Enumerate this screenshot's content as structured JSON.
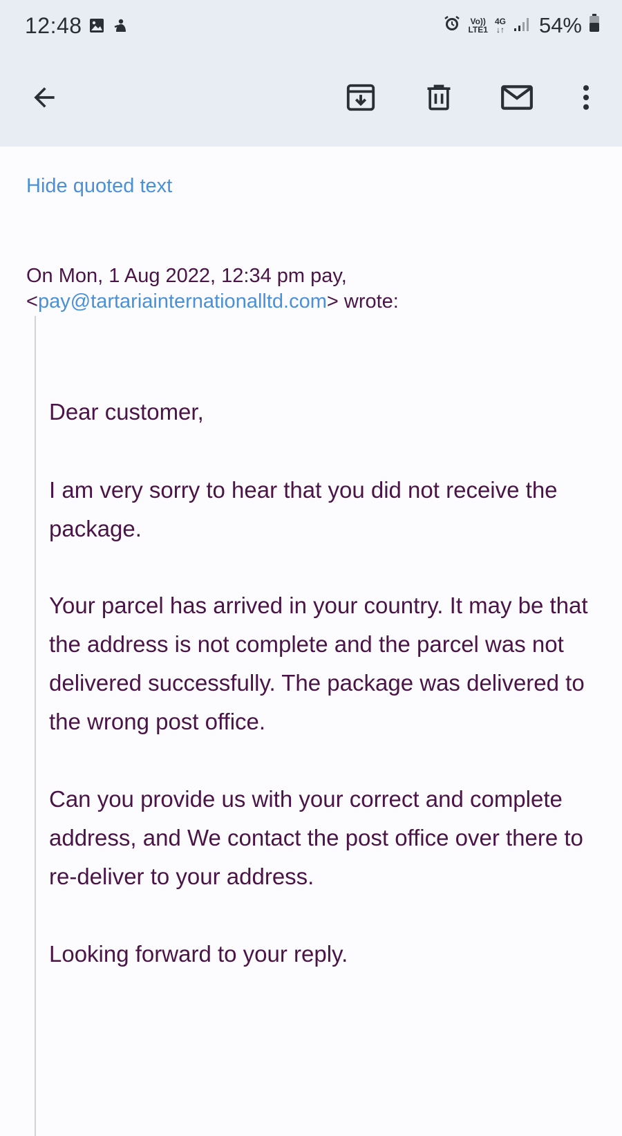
{
  "status_bar": {
    "time": "12:48",
    "left_icons": [
      "image-icon",
      "app-notification-icon"
    ],
    "right_icons": [
      "alarm-icon",
      "volte-icon",
      "4g-icon",
      "signal-icon",
      "battery-icon"
    ],
    "volte_line1": "Vo))",
    "volte_line2": "LTE1",
    "network_type": "4G",
    "battery_percent": "54%"
  },
  "toolbar": {
    "icons": [
      "back-arrow-icon",
      "archive-icon",
      "delete-icon",
      "mark-unread-icon",
      "more-options-icon"
    ]
  },
  "message": {
    "hide_quoted_label": "Hide quoted text",
    "attribution_prefix": "On Mon, 1 Aug 2022, 12:34 pm pay,",
    "sender_email": "pay@tartariainternationalltd.com",
    "attribution_suffix": "wrote:",
    "paragraphs": [
      "Dear customer,",
      "I am very sorry to hear that you did not receive the package.",
      "Your parcel has arrived in your country. It may be that the address is not complete and the parcel was not delivered successfully. The package was delivered to the wrong post office.",
      "Can you provide us with your correct and complete address, and We contact the post office over there to re-deliver to your address.",
      "Looking forward to your reply."
    ]
  },
  "colors": {
    "header_bg": "#e7edf3",
    "link": "#4a90d6",
    "body_text": "#4a1447",
    "quote_bar": "#d3d3d6"
  }
}
